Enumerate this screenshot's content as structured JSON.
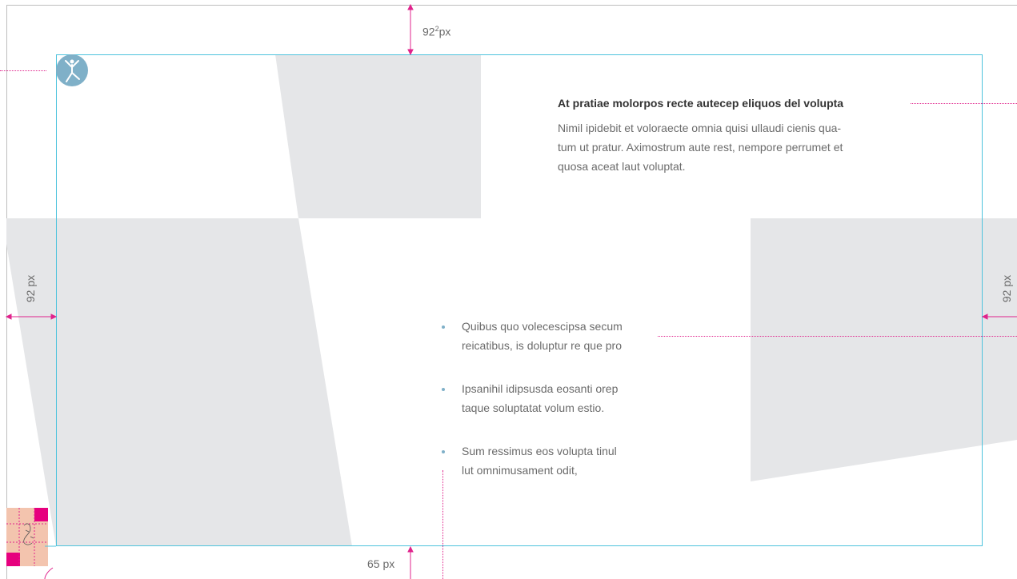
{
  "measurements": {
    "top": "92",
    "top_unit": "px",
    "left": "92 px",
    "right": "92 px",
    "bottom": "65 px"
  },
  "content": {
    "headline": "At pratiae molorpos recte autecep eliquos del volupta",
    "body_lines": [
      "Nimil ipidebit et voloraecte omnia quisi ullaudi cienis qua-",
      "tum ut pratur. Aximostrum aute rest, nempore perrumet et",
      "quosa aceat laut voluptat."
    ],
    "bullets": [
      {
        "line1": "Quibus quo volecescipsa secum",
        "line2": "reicatibus, is doluptur re que pro"
      },
      {
        "line1": "Ipsanihil idipsusda eosanti orep",
        "line2": "taque soluptatat volum estio."
      },
      {
        "line1": "Sum ressimus eos volupta tinul",
        "line2": "lut omnimusament odit,"
      }
    ]
  },
  "colors": {
    "margin_guide": "#4ec3dd",
    "annotation": "#e0238c",
    "shape_fill": "#e5e6e8",
    "logo": "#7fb0c8"
  },
  "icons": [
    "logo-person-icon",
    "hand-sketch-icon"
  ]
}
